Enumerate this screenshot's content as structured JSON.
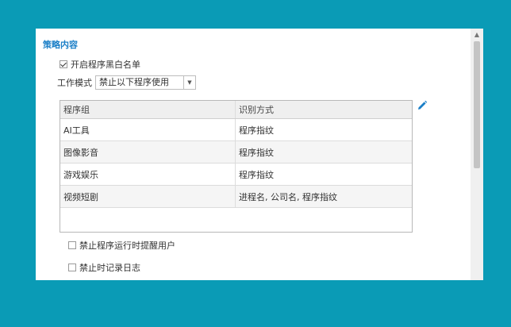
{
  "section": {
    "title": "策略内容"
  },
  "blacklist": {
    "label": "开启程序黑白名单",
    "checked": true
  },
  "mode": {
    "label": "工作模式",
    "value": "禁止以下程序使用"
  },
  "table": {
    "headers": [
      "程序组",
      "识别方式"
    ],
    "rows": [
      [
        "AI工具",
        "程序指纹"
      ],
      [
        "图像影音",
        "程序指纹"
      ],
      [
        "游戏娱乐",
        "程序指纹"
      ],
      [
        "视频短剧",
        "进程名, 公司名, 程序指纹"
      ]
    ]
  },
  "options": [
    {
      "label": "禁止程序运行时提醒用户",
      "checked": false
    },
    {
      "label": "禁止时记录日志",
      "checked": false
    }
  ],
  "colors": {
    "background": "#0a9bb6",
    "accent": "#1b7fc7"
  },
  "icons": {
    "edit": "pencil-icon",
    "scroll_up": "chevron-up-icon"
  }
}
